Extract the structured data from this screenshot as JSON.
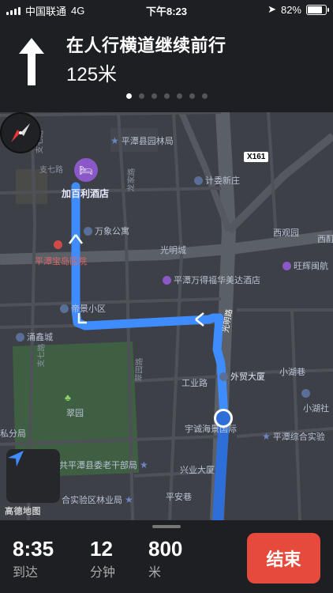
{
  "status_bar": {
    "carrier": "中国联通",
    "network": "4G",
    "time": "下午8:23",
    "battery": "82%"
  },
  "navigation": {
    "instruction": "在人行横道继续前行",
    "distance": "125米",
    "page_count": 7,
    "active_page": 1
  },
  "map": {
    "destination": "加百利酒店",
    "highway_badge": "X161",
    "roads": [
      "支七路",
      "支七路",
      "光明路",
      "龙家路",
      "光明城",
      "支七路",
      "翠园路"
    ],
    "pois": [
      {
        "label": "平潭县园林局",
        "icon": "star"
      },
      {
        "label": "计委新庄",
        "icon": "pin"
      },
      {
        "label": "万象公寓",
        "icon": "pin"
      },
      {
        "label": "西观园",
        "icon": "pin"
      },
      {
        "label": "西酊",
        "icon": "pin"
      },
      {
        "label": "平潭宝岛医院",
        "icon": "hospital"
      },
      {
        "label": "旺辉闽航",
        "icon": "hotel"
      },
      {
        "label": "平潭万得福华美达酒店",
        "icon": "hotel"
      },
      {
        "label": "帝景小区",
        "icon": "pin"
      },
      {
        "label": "涌鑫城",
        "icon": "pin"
      },
      {
        "label": "外贸大厦",
        "icon": "pin"
      },
      {
        "label": "小湖巷",
        "icon": "pin"
      },
      {
        "label": "工业路",
        "icon": "none"
      },
      {
        "label": "翠园",
        "icon": "tree"
      },
      {
        "label": "宇诚海景国际",
        "icon": "pin"
      },
      {
        "label": "小湖社",
        "icon": "pin"
      },
      {
        "label": "私分局",
        "icon": "none"
      },
      {
        "label": "平潭综合实验",
        "icon": "star"
      },
      {
        "label": "中共平潭县委老干部局",
        "icon": "star"
      },
      {
        "label": "兴业大厦",
        "icon": "pin"
      },
      {
        "label": "合实验区林业局",
        "icon": "star"
      },
      {
        "label": "平安巷",
        "icon": "none"
      }
    ],
    "attribution": "高德地图"
  },
  "trip": {
    "arrival_time": "8:35",
    "arrival_label": "到达",
    "minutes": "12",
    "minutes_label": "分钟",
    "distance": "800",
    "distance_label": "米",
    "end_button": "结束"
  },
  "colors": {
    "route": "#3f8cff",
    "end_button": "#e64a3d",
    "map_bg": "#3d4046",
    "park": "#3f5f42"
  },
  "icons": {
    "turn": "straight-arrow-icon",
    "compass": "compass-icon",
    "location": "location-arrow-icon"
  }
}
